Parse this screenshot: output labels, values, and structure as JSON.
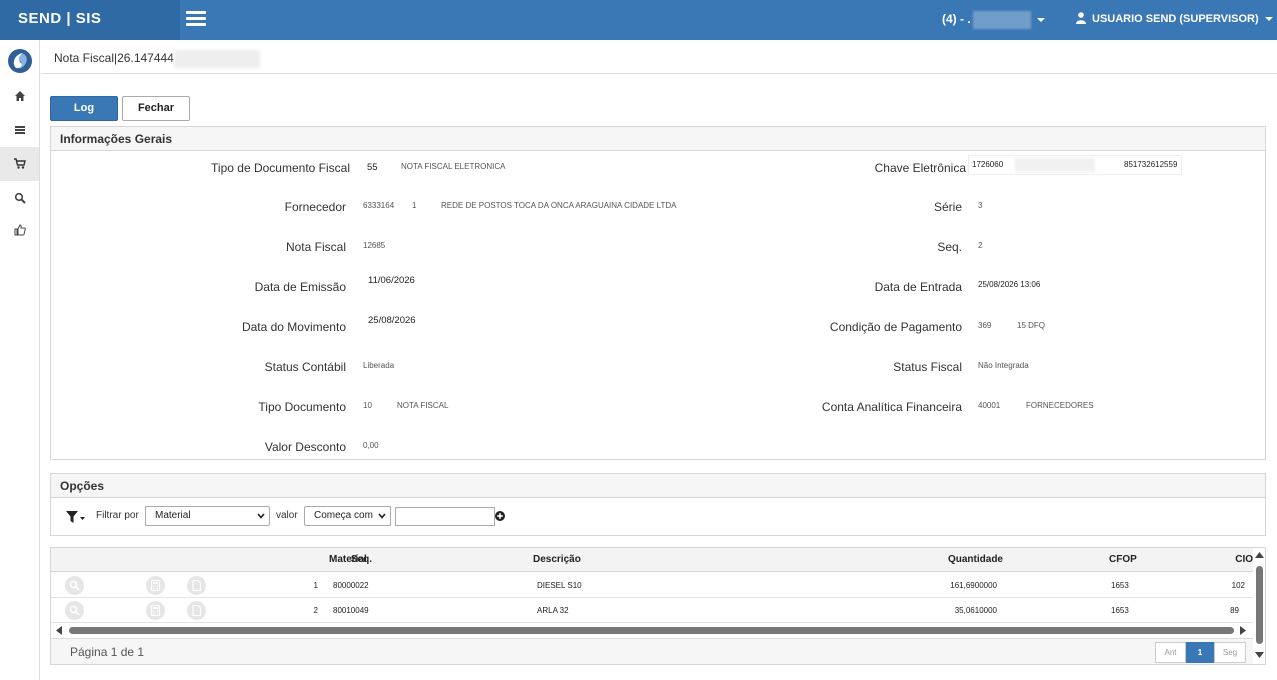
{
  "app": {
    "title": "SEND | SIS"
  },
  "topbar": {
    "company": "(4) - .",
    "user": "USUARIO SEND (SUPERVISOR)"
  },
  "breadcrumb": {
    "title": "Nota Fiscal|26.147444"
  },
  "actions": {
    "log_label": "Log",
    "close_label": "Fechar"
  },
  "info_panel": {
    "title": "Informações Gerais",
    "tipo_doc_fiscal": {
      "label": "Tipo de Documento Fiscal",
      "code": "55",
      "desc": "NOTA FISCAL ELETRONICA"
    },
    "fornecedor": {
      "label": "Fornecedor",
      "code": "6333164",
      "sub": "1",
      "name": "REDE DE POSTOS TOCA DA ONCA ARAGUAINA CIDADE LTDA"
    },
    "nota_fiscal": {
      "label": "Nota Fiscal",
      "value": "12685"
    },
    "data_emissao": {
      "label": "Data de Emissão",
      "value": "11/06/2026"
    },
    "data_movimento": {
      "label": "Data do Movimento",
      "value": "25/08/2026"
    },
    "status_contabil": {
      "label": "Status Contábil",
      "value": "Liberada"
    },
    "tipo_documento": {
      "label": "Tipo Documento",
      "code": "10",
      "desc": "NOTA FISCAL"
    },
    "valor_desconto": {
      "label": "Valor Desconto",
      "value": "0,00"
    },
    "chave": {
      "label": "Chave Eletrônica",
      "start": "1726060",
      "end": "851732612559"
    },
    "serie": {
      "label": "Série",
      "value": "3"
    },
    "seq": {
      "label": "Seq.",
      "value": "2"
    },
    "data_entrada": {
      "label": "Data de Entrada",
      "value": "25/08/2026 13:06"
    },
    "cond_pagamento": {
      "label": "Condição de Pagamento",
      "code": "369",
      "desc": "15 DFQ"
    },
    "status_fiscal": {
      "label": "Status Fiscal",
      "value": "Não Integrada"
    },
    "conta_analitica": {
      "label": "Conta Analítica Financeira",
      "code": "40001",
      "desc": "FORNECEDORES"
    }
  },
  "options_panel": {
    "title": "Opções",
    "filter_by_label": "Filtrar por",
    "filter_field": "Material",
    "value_label": "valor",
    "operator": "Começa com",
    "value": ""
  },
  "grid": {
    "columns": {
      "seq": "Seq.",
      "material": "Material",
      "descricao": "Descrição",
      "quantidade": "Quantidade",
      "cfop": "CFOP",
      "cio": "CIO"
    },
    "rows": [
      {
        "seq": "1",
        "material": "80000022",
        "descricao": "DIESEL S10",
        "quantidade": "161,6900000",
        "cfop": "1653",
        "cio": "102"
      },
      {
        "seq": "2",
        "material": "80010049",
        "descricao": "ARLA 32",
        "quantidade": "35,0610000",
        "cfop": "1653",
        "cio": "89"
      }
    ],
    "page_info": "Página 1 de 1",
    "pager": {
      "prev": "Ant",
      "current": "1",
      "next": "Seg"
    }
  },
  "colors": {
    "primary": "#3a78b5",
    "brand_bg": "#2f6aa5"
  }
}
